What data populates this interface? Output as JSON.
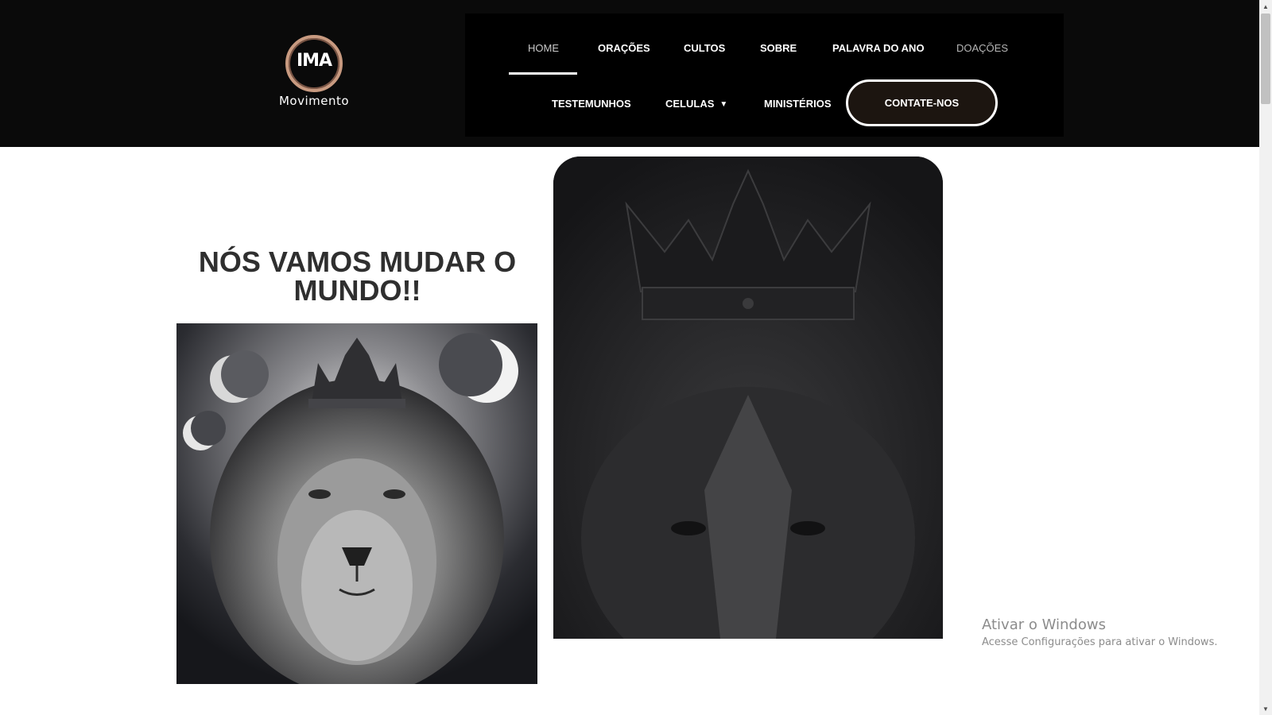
{
  "header": {
    "logo": {
      "mark": "IMA",
      "wordmark": "Movimento"
    },
    "nav": {
      "home": "HOME",
      "oracoes": "ORAÇÕES",
      "cultos": "CULTOS",
      "sobre": "SOBRE",
      "palavra_do_ano": "PALAVRA DO ANO",
      "doacoes": "DOAÇÕES",
      "testemunhos": "TESTEMUNHOS",
      "celulas": "CELULAS",
      "ministerios": "MINISTÉRIOS",
      "contact_button": "CONTATE-NOS"
    },
    "active_item": "HOME"
  },
  "main": {
    "hero_title": "NÓS VAMOS MUDAR O MUNDO!!"
  },
  "icons": {
    "celulas_dropdown": "chevron-down-icon",
    "scroll_up": "triangle-up-icon",
    "scroll_down": "triangle-down-icon"
  },
  "windows_watermark": {
    "title": "Ativar o Windows",
    "subtitle": "Acesse Configurações para ativar o Windows."
  },
  "colors": {
    "header_bg": "#0a0a0a",
    "nav_bg": "#000000",
    "logo_ring": "#c89a80",
    "title_text": "#2f2f2f",
    "button_fill": "#1c1510"
  }
}
